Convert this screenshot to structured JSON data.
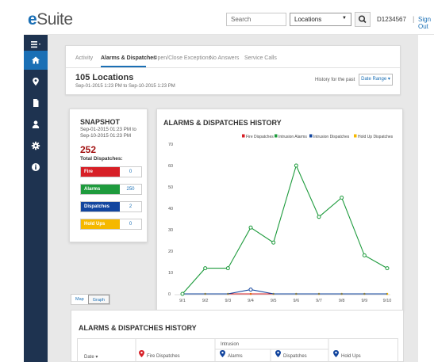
{
  "header": {
    "logo_e": "e",
    "logo_rest": "Suite",
    "search_placeholder": "Search",
    "location_select": "Locations",
    "account_id": "D1234567",
    "separator": "|",
    "sign_out": "Sign Out"
  },
  "sidebar": {
    "items": [
      {
        "icon": "menu-icon"
      },
      {
        "icon": "home-icon"
      },
      {
        "icon": "location-pin-icon"
      },
      {
        "icon": "document-icon"
      },
      {
        "icon": "user-icon"
      },
      {
        "icon": "gear-icon"
      },
      {
        "icon": "info-icon"
      }
    ]
  },
  "tabs": {
    "items": [
      {
        "label": "Activity",
        "active": false
      },
      {
        "label": "Alarms & Dispatches",
        "active": true
      },
      {
        "label": "Open/Close Exceptions",
        "active": false
      },
      {
        "label": "No Answers",
        "active": false
      },
      {
        "label": "Service Calls",
        "active": false
      }
    ],
    "locations_count": "105 Locations",
    "locations_range": "Sep-01-2015 1:23 PM to Sep-10-2015 1:23 PM",
    "history_label": "History for the past",
    "date_range_button": "Date Range ▾"
  },
  "snapshot": {
    "title": "SNAPSHOT",
    "range": "Sep-01-2015 01:23 PM to Sep-10-2015 01:23 PM",
    "total": "252",
    "total_label": "Total Dispatches:",
    "rows": [
      {
        "label": "Fire",
        "value": "0",
        "color": "#d71f26"
      },
      {
        "label": "Alarms",
        "value": "250",
        "color": "#1e9b3d"
      },
      {
        "label": "Dispatches",
        "value": "2",
        "color": "#12459e"
      },
      {
        "label": "Hold Ups",
        "value": "0",
        "color": "#f5b800"
      }
    ]
  },
  "chart_data": {
    "type": "line",
    "title": "ALARMS & DISPATCHES HISTORY",
    "categories": [
      "9/1",
      "9/2",
      "9/3",
      "9/4",
      "9/5",
      "9/6",
      "9/7",
      "9/8",
      "9/9",
      "9/10"
    ],
    "ylim": [
      0,
      70
    ],
    "yticks": [
      0,
      10,
      20,
      30,
      40,
      50,
      60,
      70
    ],
    "grid": false,
    "legend_position": "top-right",
    "series": [
      {
        "name": "Fire Dispatches",
        "color": "#d71f26",
        "values": [
          0,
          0,
          0,
          0,
          0,
          0,
          0,
          0,
          0,
          0
        ]
      },
      {
        "name": "Intrusion Alarms",
        "color": "#1e9b3d",
        "values": [
          0,
          12,
          12,
          31,
          24,
          60,
          36,
          45,
          18,
          12
        ]
      },
      {
        "name": "Intrusion Dispatches",
        "color": "#12459e",
        "values": [
          0,
          0,
          0,
          2,
          0,
          0,
          0,
          0,
          0,
          0
        ]
      },
      {
        "name": "Hold Up Dispatches",
        "color": "#f5b800",
        "values": [
          0,
          0,
          0,
          0,
          0,
          0,
          0,
          0,
          0,
          0
        ]
      }
    ]
  },
  "view_toggle": {
    "options": [
      "Map",
      "Graph"
    ],
    "selected": "Graph"
  },
  "history_table": {
    "title": "ALARMS & DISPATCHES HISTORY",
    "group_header": "Intrusion",
    "columns": [
      {
        "label": "Date ▾"
      },
      {
        "label": "Fire Dispatches",
        "pin_color": "#d71f26"
      },
      {
        "label": "Alarms",
        "pin_color": "#12459e"
      },
      {
        "label": "Dispatches",
        "pin_color": "#12459e"
      },
      {
        "label": "Hold Ups",
        "pin_color": "#12459e"
      }
    ]
  }
}
